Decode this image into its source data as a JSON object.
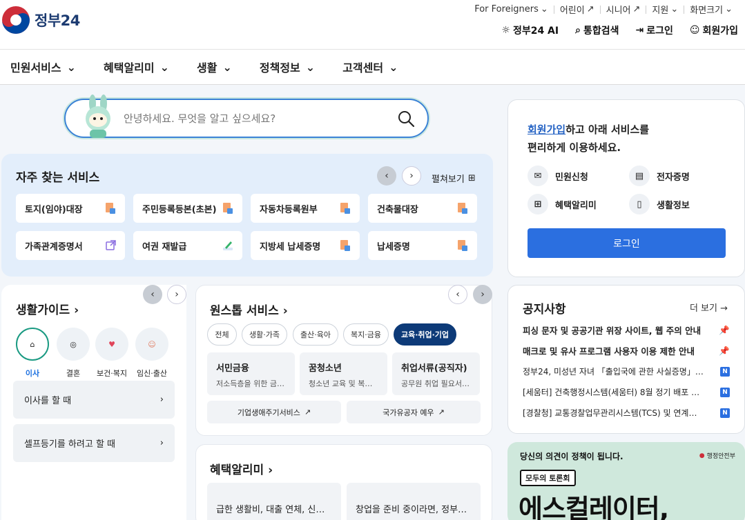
{
  "header": {
    "logo_text": "정부24",
    "util_links": [
      "For Foreigners",
      "어린이",
      "시니어",
      "지원",
      "화면크기"
    ],
    "gnb": [
      "정부24 AI",
      "통합검색",
      "로그인",
      "회원가입"
    ]
  },
  "nav": [
    "민원서비스",
    "혜택알리미",
    "생활",
    "정책정보",
    "고객센터"
  ],
  "search": {
    "placeholder": "안녕하세요. 무엇을 알고 싶으세요?"
  },
  "frequent": {
    "title": "자주 찾는 서비스",
    "expand": "펼쳐보기",
    "items": [
      "토지(임야)대장",
      "주민등록등본(초본)",
      "자동차등록원부",
      "건축물대장",
      "가족관계증명서",
      "여권 재발급",
      "지방세 납세증명",
      "납세증명"
    ]
  },
  "login_panel": {
    "msg_link": "회원가입",
    "msg_rest1": "하고 아래 서비스를",
    "msg_rest2": "편리하게 이용하세요.",
    "services": [
      "민원신청",
      "전자증명",
      "혜택알리미",
      "생활정보"
    ],
    "button": "로그인"
  },
  "life_guide": {
    "title": "생활가이드",
    "categories": [
      "이사",
      "결혼",
      "보건·복지",
      "임신·출산"
    ],
    "rows": [
      "이사를 할 때",
      "셀프등기를 하려고 할 때"
    ]
  },
  "onestop": {
    "title": "원스톱 서비스",
    "chips": [
      "전체",
      "생활·가족",
      "출산·육아",
      "복지·금융",
      "교육·취업·기업"
    ],
    "cards": [
      {
        "title": "서민금융",
        "desc": "저소득층을 위한 금융…"
      },
      {
        "title": "꿈청소년",
        "desc": "청소년 교육 및 복지 …"
      },
      {
        "title": "취업서류(공직자)",
        "desc": "공무원 취업 필요서류…"
      }
    ],
    "links": [
      "기업생애주기서비스",
      "국가유공자 예우"
    ]
  },
  "benefit": {
    "title": "혜택알리미",
    "cards": [
      "급한 생활비, 대출 연체, 신용…",
      "창업을 준비 중이라면, 정부…"
    ]
  },
  "notice": {
    "title": "공지사항",
    "more": "더 보기 →",
    "pinned": [
      "피싱 문자 및 공공기관 위장 사이트, 웹 주의 안내",
      "매크로 및 유사 프로그램 사용자 이용 제한 안내"
    ],
    "items": [
      "정부24, 미성년 자녀 「출입국에 관한 사실증명」…",
      "[세움터] 건축행정시스템(세움터) 8월 정기 배포 …",
      "[경찰청] 교통경찰업무관리시스템(TCS) 및 연계…"
    ],
    "badge": "N"
  },
  "banner": {
    "headline": "당신의 의견이 정책이 됩니다.",
    "org": "행정안전부",
    "tag": "모두의 토론회",
    "big": "에스컬레이터,"
  }
}
